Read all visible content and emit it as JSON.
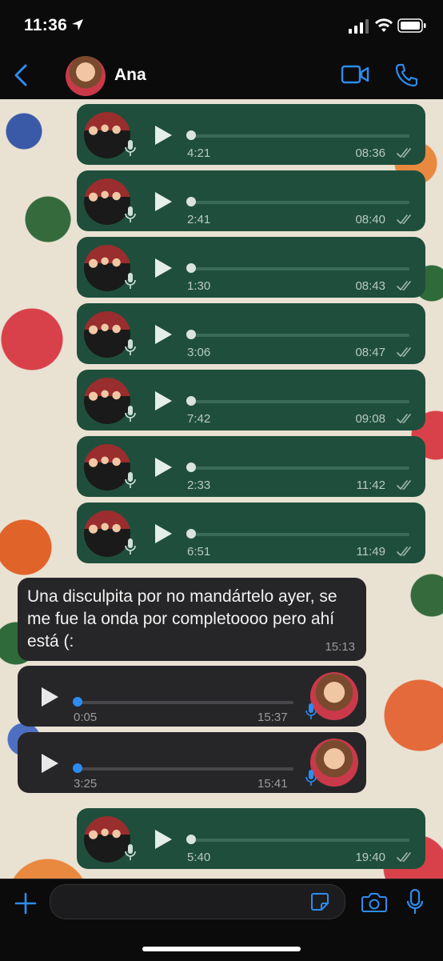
{
  "status_bar": {
    "time": "11:36"
  },
  "header": {
    "contact_name": "Ana"
  },
  "messages": {
    "out1": {
      "duration": "4:21",
      "time": "08:36"
    },
    "out2": {
      "duration": "2:41",
      "time": "08:40"
    },
    "out3": {
      "duration": "1:30",
      "time": "08:43"
    },
    "out4": {
      "duration": "3:06",
      "time": "08:47"
    },
    "out5": {
      "duration": "7:42",
      "time": "09:08"
    },
    "out6": {
      "duration": "2:33",
      "time": "11:42"
    },
    "out7": {
      "duration": "6:51",
      "time": "11:49"
    },
    "in_text": {
      "text": "Una disculpita por no mandártelo ayer, se me fue la onda por completoooo pero ahí está (:",
      "time": "15:13"
    },
    "in_voice1": {
      "duration": "0:05",
      "time": "15:37"
    },
    "in_voice2": {
      "duration": "3:25",
      "time": "15:41"
    },
    "out8": {
      "duration": "5:40",
      "time": "19:40"
    }
  },
  "input": {
    "placeholder": ""
  },
  "colors": {
    "accent": "#2d8cf0",
    "outgoing_bubble": "#1f4f3c",
    "incoming_bubble": "#262628"
  }
}
